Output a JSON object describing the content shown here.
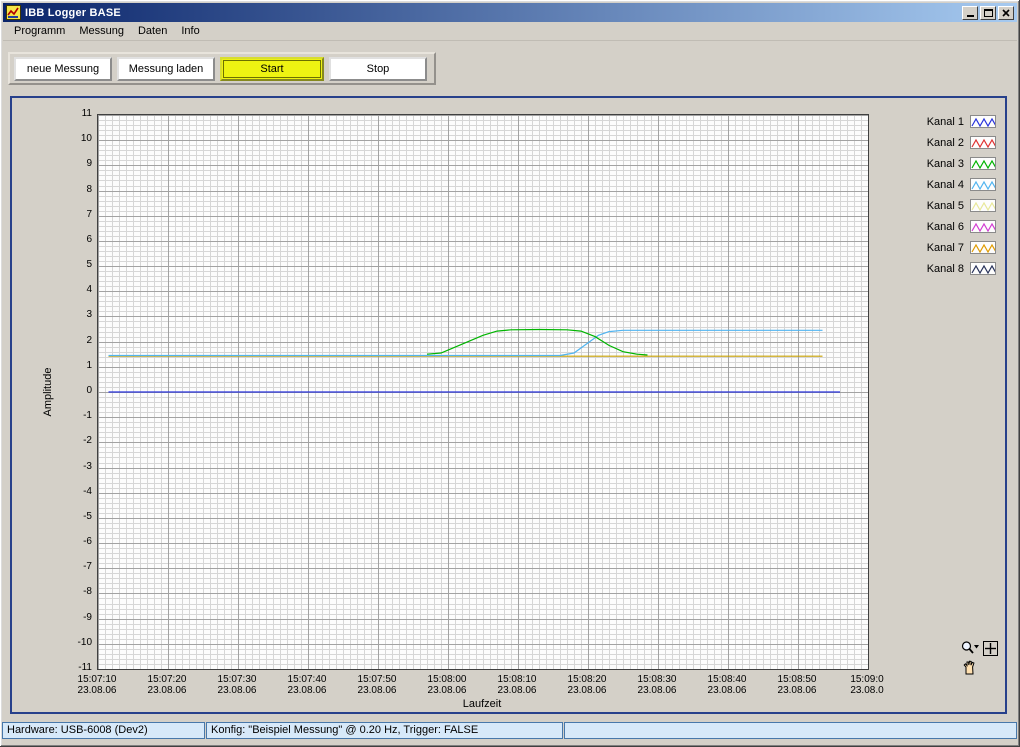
{
  "window": {
    "title": "IBB Logger BASE"
  },
  "menu": {
    "items": [
      "Programm",
      "Messung",
      "Daten",
      "Info"
    ]
  },
  "toolbar": {
    "buttons": [
      {
        "label": "neue Messung",
        "active": false
      },
      {
        "label": "Messung laden",
        "active": false
      },
      {
        "label": "Start",
        "active": true
      },
      {
        "label": "Stop",
        "active": false
      }
    ]
  },
  "chart_data": {
    "type": "line",
    "xlabel": "Laufzeit",
    "ylabel": "Amplitude",
    "ylim": [
      -11,
      11
    ],
    "x_range_seconds": [
      0,
      110
    ],
    "x_start_time": "15:07:10",
    "y_ticks": [
      11,
      10,
      9,
      8,
      7,
      6,
      5,
      4,
      3,
      2,
      1,
      0,
      -1,
      -2,
      -3,
      -4,
      -5,
      -6,
      -7,
      -8,
      -9,
      -10,
      -11
    ],
    "x_tick_labels": [
      {
        "time": "15:07:10",
        "date": "23.08.06"
      },
      {
        "time": "15:07:20",
        "date": "23.08.06"
      },
      {
        "time": "15:07:30",
        "date": "23.08.06"
      },
      {
        "time": "15:07:40",
        "date": "23.08.06"
      },
      {
        "time": "15:07:50",
        "date": "23.08.06"
      },
      {
        "time": "15:08:00",
        "date": "23.08.06"
      },
      {
        "time": "15:08:10",
        "date": "23.08.06"
      },
      {
        "time": "15:08:20",
        "date": "23.08.06"
      },
      {
        "time": "15:08:30",
        "date": "23.08.06"
      },
      {
        "time": "15:08:40",
        "date": "23.08.06"
      },
      {
        "time": "15:08:50",
        "date": "23.08.06"
      },
      {
        "time": "15:09:0",
        "date": "23.08.0"
      }
    ],
    "grid": {
      "x_minor": 1,
      "x_major": 10,
      "y_minor": 0.2,
      "y_major": 1,
      "minor_color": "#d6d6d6",
      "major_color": "#a2a2a2"
    },
    "series": [
      {
        "name": "Kanal 7",
        "color": "#c8a000",
        "points": [
          [
            1.5,
            1.42
          ],
          [
            103.5,
            1.42
          ]
        ]
      },
      {
        "name": "Kanal 4",
        "color": "#50b4f0",
        "points": [
          [
            1.5,
            1.45
          ],
          [
            66,
            1.45
          ],
          [
            68,
            1.55
          ],
          [
            70,
            1.95
          ],
          [
            71.5,
            2.25
          ],
          [
            73,
            2.4
          ],
          [
            75,
            2.45
          ],
          [
            103.5,
            2.45
          ]
        ]
      },
      {
        "name": "Kanal 3",
        "color": "#00b400",
        "points": [
          [
            47,
            1.5
          ],
          [
            49,
            1.55
          ],
          [
            52,
            1.9
          ],
          [
            55,
            2.25
          ],
          [
            57,
            2.42
          ],
          [
            59,
            2.47
          ],
          [
            63,
            2.48
          ],
          [
            67,
            2.47
          ],
          [
            69,
            2.42
          ],
          [
            71,
            2.2
          ],
          [
            73,
            1.85
          ],
          [
            75,
            1.6
          ],
          [
            77,
            1.5
          ],
          [
            78.5,
            1.47
          ]
        ]
      },
      {
        "name": "Kanal 1",
        "color": "#2832dc",
        "points": [
          [
            1.5,
            0
          ],
          [
            106,
            0
          ]
        ]
      }
    ]
  },
  "legend": {
    "items": [
      {
        "label": "Kanal 1",
        "color": "#2832dc"
      },
      {
        "label": "Kanal 2",
        "color": "#e03232"
      },
      {
        "label": "Kanal 3",
        "color": "#00b400"
      },
      {
        "label": "Kanal 4",
        "color": "#50b4f0"
      },
      {
        "label": "Kanal 5",
        "color": "#e8e89a"
      },
      {
        "label": "Kanal 6",
        "color": "#d23cd2"
      },
      {
        "label": "Kanal 7",
        "color": "#e09b00"
      },
      {
        "label": "Kanal 8",
        "color": "#28325a"
      }
    ]
  },
  "statusbar": {
    "hardware": "Hardware: USB-6008 (Dev2)",
    "konfig": "Konfig: \"Beispiel Messung\" @ 0.20 Hz, Trigger: FALSE"
  }
}
